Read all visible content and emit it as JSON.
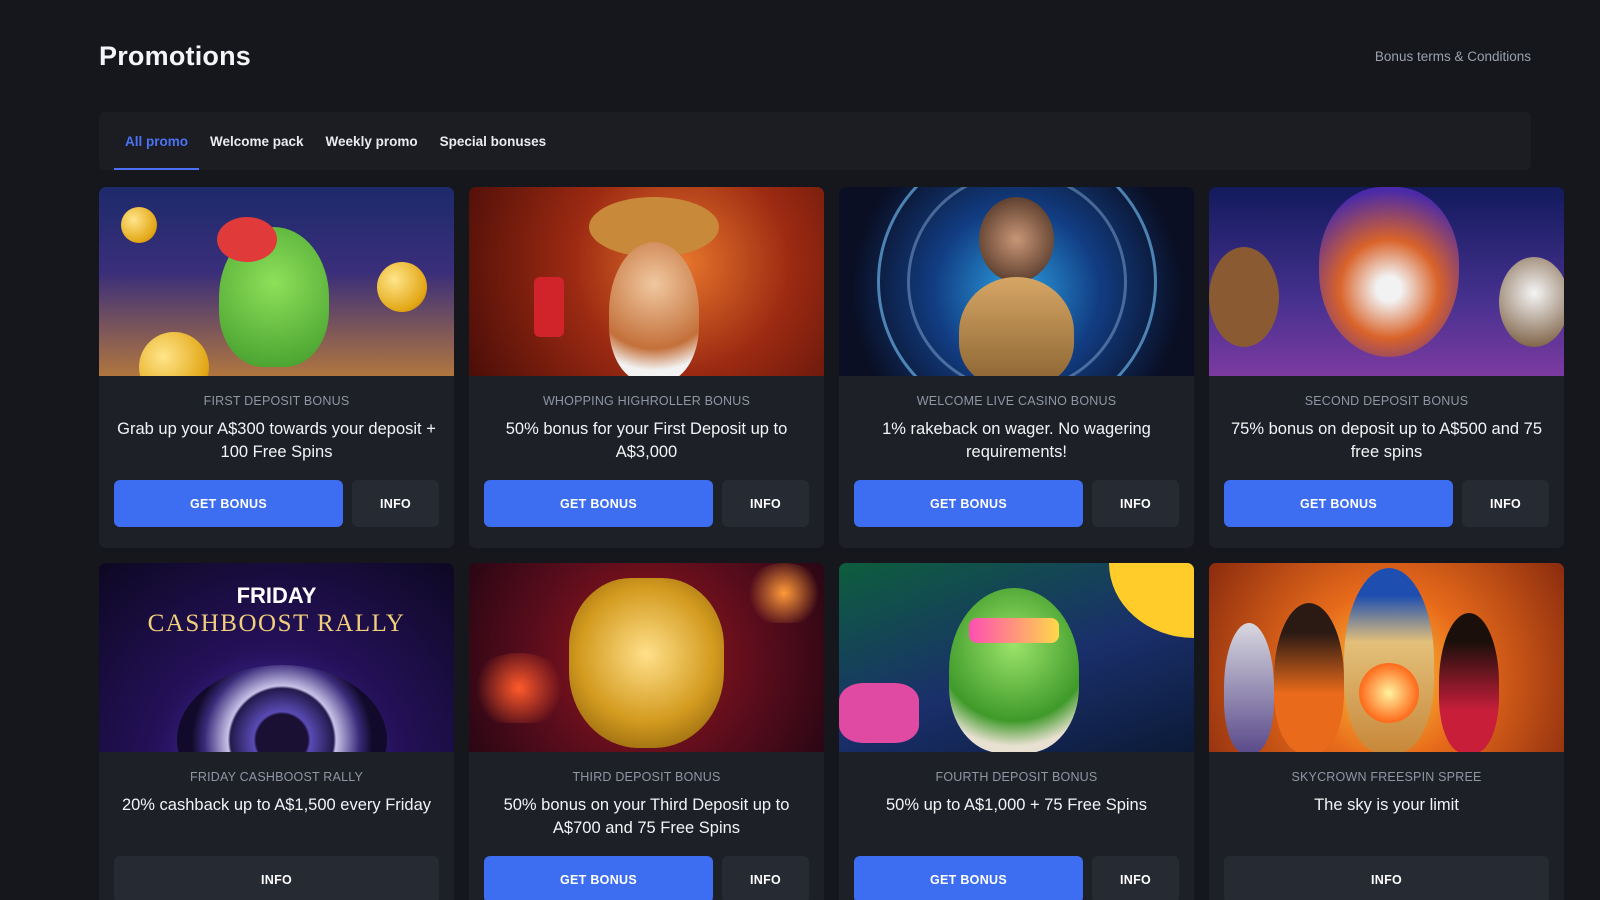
{
  "header": {
    "title": "Promotions",
    "terms_link": "Bonus terms & Conditions"
  },
  "tabs": [
    {
      "label": "All promo",
      "active": true
    },
    {
      "label": "Welcome pack",
      "active": false
    },
    {
      "label": "Weekly promo",
      "active": false
    },
    {
      "label": "Special bonuses",
      "active": false
    }
  ],
  "buttons": {
    "get_bonus": "GET BONUS",
    "info": "INFO"
  },
  "cards": [
    {
      "label": "FIRST DEPOSIT BONUS",
      "description": "Grab up your A$300 towards your deposit + 100 Free Spins",
      "has_get_bonus": true
    },
    {
      "label": "WHOPPING HIGHROLLER BONUS",
      "description": "50% bonus for your First Deposit up to A$3,000",
      "has_get_bonus": true
    },
    {
      "label": "WELCOME LIVE CASINO BONUS",
      "description": "1% rakeback on wager. No wagering requirements!",
      "has_get_bonus": true
    },
    {
      "label": "SECOND DEPOSIT BONUS",
      "description": "75% bonus on deposit up to A$500 and 75 free spins",
      "has_get_bonus": true
    },
    {
      "label": "FRIDAY CASHBOOST RALLY",
      "description": "20% cashback up to A$1,500 every Friday",
      "has_get_bonus": false,
      "image_text_1": "FRIDAY",
      "image_text_2": "CASHBOOST RALLY"
    },
    {
      "label": "THIRD DEPOSIT BONUS",
      "description": "50% bonus on your Third Deposit up to A$700 and 75 Free Spins",
      "has_get_bonus": true
    },
    {
      "label": "FOURTH DEPOSIT BONUS",
      "description": "50% up to A$1,000 + 75 Free Spins",
      "has_get_bonus": true
    },
    {
      "label": "SKYCROWN FREESPIN SPREE",
      "description": "The sky is your limit",
      "has_get_bonus": false
    }
  ],
  "colors": {
    "background": "#15171c",
    "card": "#1d2027",
    "accent": "#3d6df1",
    "tab_active": "#4b72f5"
  }
}
